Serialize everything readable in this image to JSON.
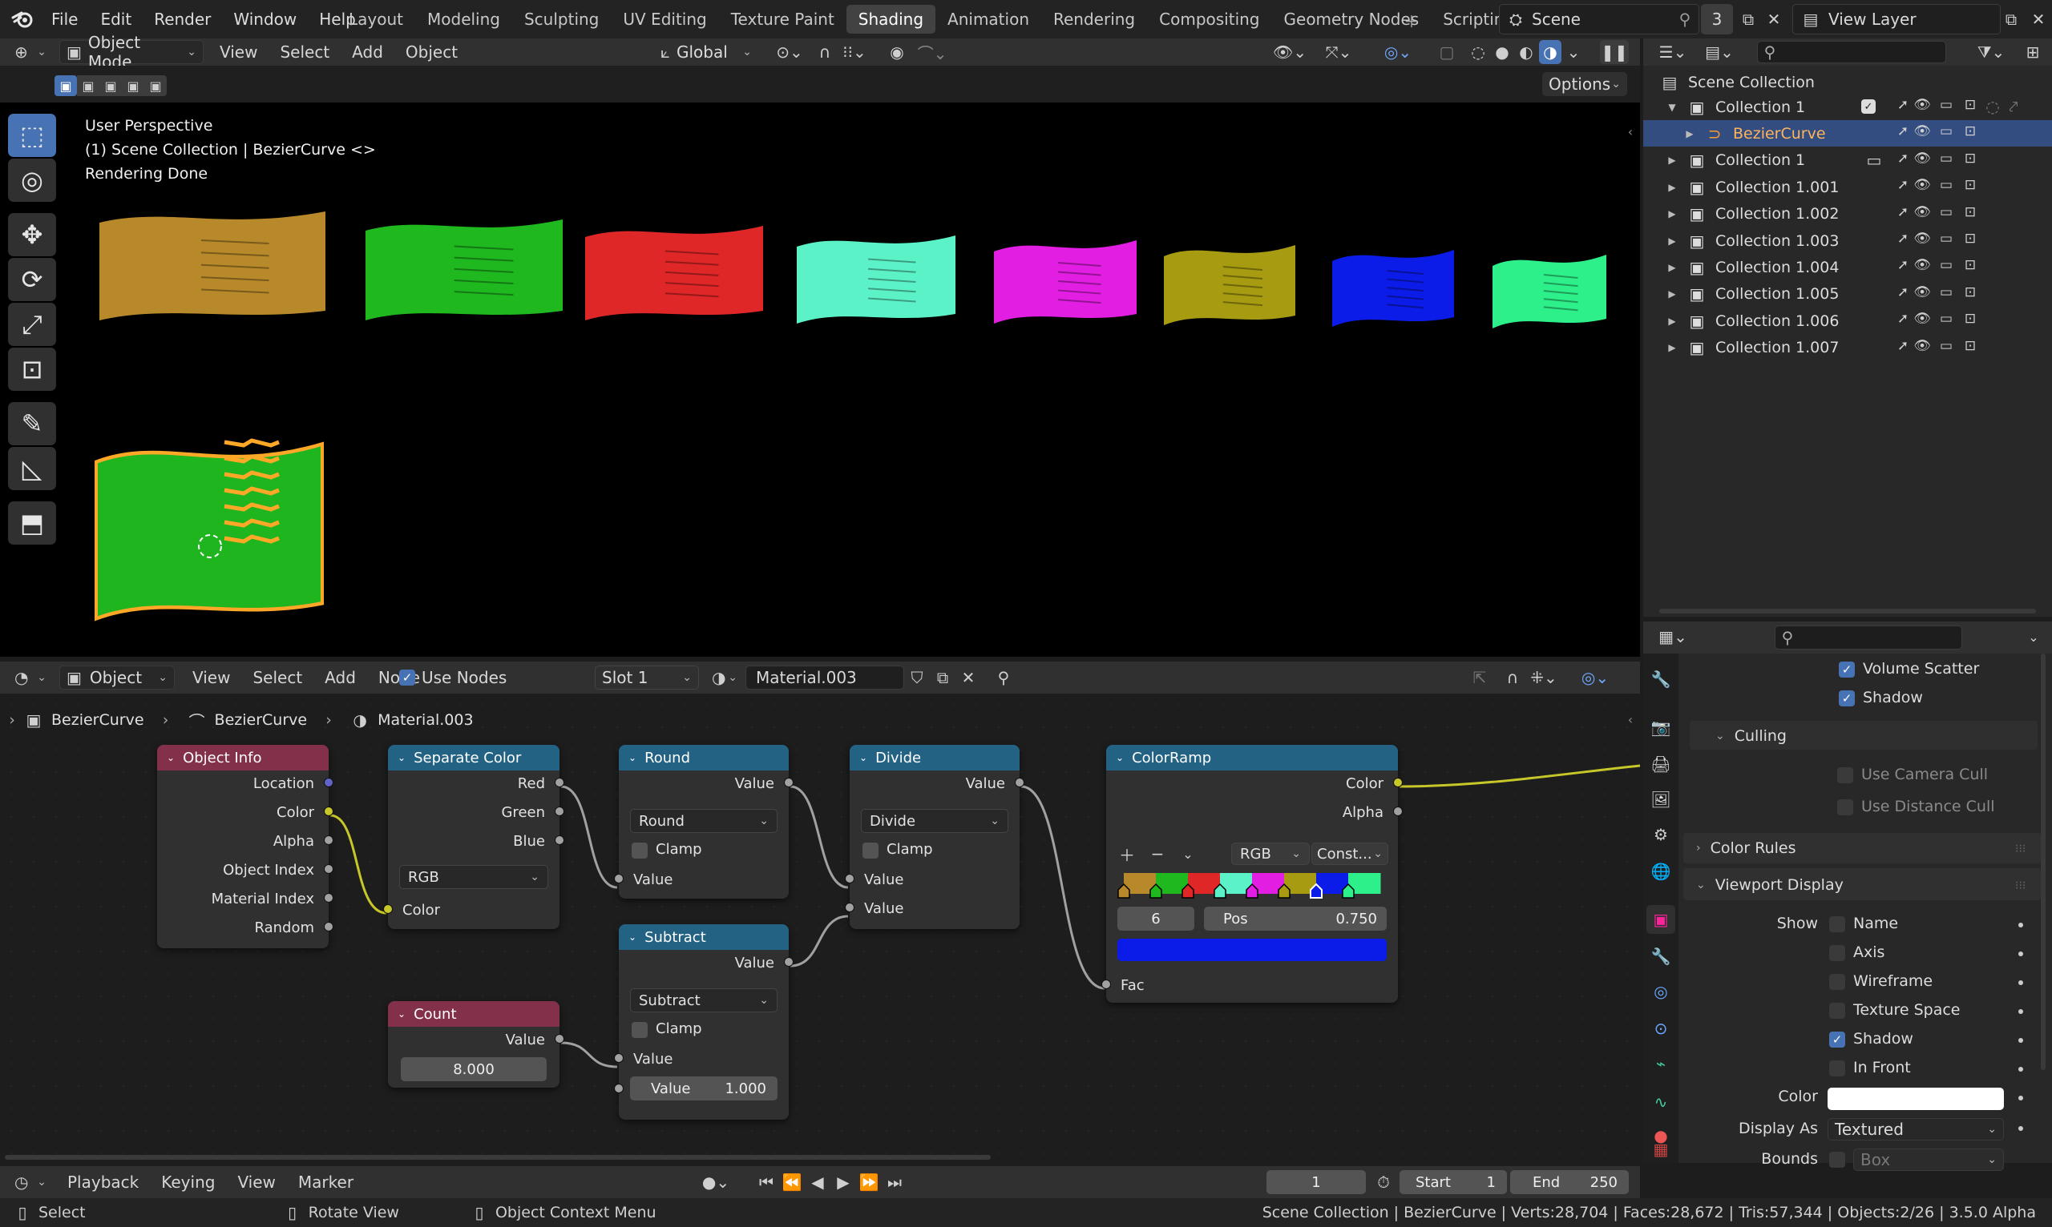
{
  "menubar": {
    "menus": [
      "File",
      "Edit",
      "Render",
      "Window",
      "Help"
    ],
    "workspaces": [
      "Layout",
      "Modeling",
      "Sculpting",
      "UV Editing",
      "Texture Paint",
      "Shading",
      "Animation",
      "Rendering",
      "Compositing",
      "Geometry Nodes",
      "Scripting"
    ],
    "active_workspace": "Shading",
    "scene_name": "Scene",
    "scene_users": "3",
    "view_layer": "View Layer"
  },
  "viewport": {
    "mode": "Object Mode",
    "menus": [
      "View",
      "Select",
      "Add",
      "Object"
    ],
    "transform_orientation": "Global",
    "options_label": "Options",
    "overlay_line1": "User Perspective",
    "overlay_line2": "(1) Scene Collection | BezierCurve <>",
    "overlay_line3": "Rendering Done",
    "flag_colors": [
      "#b8892a",
      "#1fb81f",
      "#e02727",
      "#5cf2c8",
      "#e11ee1",
      "#a79b12",
      "#0c1ce8",
      "#2ef08a"
    ],
    "active_flag_color": "#1fb51f"
  },
  "outliner": {
    "root": "Scene Collection",
    "items": [
      {
        "label": "Collection 1",
        "level": 1,
        "expanded": true
      },
      {
        "label": "BezierCurve",
        "level": 2,
        "selected": true
      },
      {
        "label": "Collection 1",
        "level": 1
      },
      {
        "label": "Collection 1.001",
        "level": 1
      },
      {
        "label": "Collection 1.002",
        "level": 1
      },
      {
        "label": "Collection 1.003",
        "level": 1
      },
      {
        "label": "Collection 1.004",
        "level": 1
      },
      {
        "label": "Collection 1.005",
        "level": 1
      },
      {
        "label": "Collection 1.006",
        "level": 1
      },
      {
        "label": "Collection 1.007",
        "level": 1
      }
    ]
  },
  "node_editor": {
    "editor_type": "Object",
    "menus": [
      "View",
      "Select",
      "Add",
      "Node"
    ],
    "use_nodes_label": "Use Nodes",
    "slot": "Slot 1",
    "material": "Material.003",
    "breadcrumb": [
      "BezierCurve",
      "BezierCurve",
      "Material.003"
    ],
    "nodes": {
      "object_info": {
        "title": "Object Info",
        "outputs": [
          "Location",
          "Color",
          "Alpha",
          "Object Index",
          "Material Index",
          "Random"
        ]
      },
      "separate_color": {
        "title": "Separate Color",
        "outputs": [
          "Red",
          "Green",
          "Blue"
        ],
        "mode": "RGB",
        "input": "Color"
      },
      "round": {
        "title": "Round",
        "output": "Value",
        "op": "Round",
        "clamp": "Clamp",
        "input": "Value"
      },
      "subtract": {
        "title": "Subtract",
        "output": "Value",
        "op": "Subtract",
        "clamp": "Clamp",
        "input": "Value",
        "value_label": "Value",
        "value": "1.000"
      },
      "divide": {
        "title": "Divide",
        "output": "Value",
        "op": "Divide",
        "clamp": "Clamp",
        "input1": "Value",
        "input2": "Value"
      },
      "count": {
        "title": "Count",
        "output": "Value",
        "value": "8.000"
      },
      "colorramp": {
        "title": "ColorRamp",
        "out_color": "Color",
        "out_alpha": "Alpha",
        "color_mode": "RGB",
        "interp": "Const...",
        "active_index": "6",
        "pos_label": "Pos",
        "pos_value": "0.750",
        "fac": "Fac",
        "stops": [
          "#b8892a",
          "#1fb81f",
          "#e02727",
          "#5cf2c8",
          "#e11ee1",
          "#a79b12",
          "#0c1ce8",
          "#2ef08a"
        ],
        "active_color": "#0c1ce8"
      }
    }
  },
  "properties": {
    "volume_scatter": "Volume Scatter",
    "shadow": "Shadow",
    "culling": "Culling",
    "use_camera_cull": "Use Camera Cull",
    "use_distance_cull": "Use Distance Cull",
    "color_rules": "Color Rules",
    "viewport_display": "Viewport Display",
    "show_label": "Show",
    "show_items": [
      {
        "label": "Name",
        "checked": false
      },
      {
        "label": "Axis",
        "checked": false
      },
      {
        "label": "Wireframe",
        "checked": false
      },
      {
        "label": "Texture Space",
        "checked": false
      },
      {
        "label": "Shadow",
        "checked": true
      },
      {
        "label": "In Front",
        "checked": false
      }
    ],
    "color_label": "Color",
    "display_as_label": "Display As",
    "display_as_value": "Textured",
    "bounds_label": "Bounds",
    "bounds_value": "Box"
  },
  "timeline": {
    "menus": [
      "Playback",
      "Keying",
      "View",
      "Marker"
    ],
    "current_frame": "1",
    "start_label": "Start",
    "start": "1",
    "end_label": "End",
    "end": "250"
  },
  "statusbar": {
    "select": "Select",
    "rotate": "Rotate View",
    "context": "Object Context Menu",
    "stats": "Scene Collection | BezierCurve | Verts:28,704 | Faces:28,672 | Tris:57,344 | Objects:2/26 | 3.5.0 Alpha"
  }
}
